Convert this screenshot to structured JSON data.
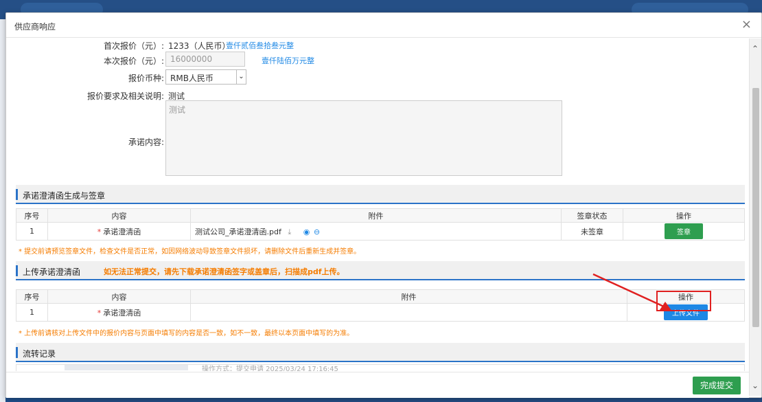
{
  "modal": {
    "title": "供应商响应"
  },
  "form": {
    "first_quote_label": "首次报价（元）:",
    "first_quote_value": "1233（人民币）",
    "first_quote_words": "壹仟贰佰叁拾叁元整",
    "this_quote_label": "本次报价（元）:",
    "this_quote_value": "16000000",
    "this_quote_words": "壹仟陆佰万元整",
    "currency_label": "报价币种:",
    "currency_value": "RMB人民币",
    "requirement_label": "报价要求及相关说明:",
    "requirement_value": "测试",
    "commitment_label": "承诺内容:",
    "commitment_value": "测试"
  },
  "section1": {
    "title": "承诺澄清函生成与签章",
    "headers": [
      "序号",
      "内容",
      "附件",
      "签章状态",
      "操作"
    ],
    "rows": [
      {
        "no": "1",
        "content": "承诺澄清函",
        "attachment": "测试公司_承诺澄清函.pdf",
        "status": "未签章",
        "action": "签章"
      }
    ],
    "note": "* 提交前请预览签章文件，检查文件是否正常，如因网络波动导致签章文件损坏，请删除文件后重新生成并签章。"
  },
  "section2": {
    "title": "上传承诺澄清函",
    "warning": "如无法正常提交，请先下载承诺澄清函签字或盖章后，扫描成pdf上传。",
    "headers": [
      "序号",
      "内容",
      "附件",
      "操作"
    ],
    "rows": [
      {
        "no": "1",
        "content": "承诺澄清函",
        "attachment": "",
        "action": "上传文件"
      }
    ],
    "note": "* 上传前请核对上传文件中的报价内容与页面中填写的内容是否一致，如不一致，最终以本页面中填写的为准。"
  },
  "section3": {
    "title": "流转记录",
    "partial_row": "操作方式：提交申请  2025/03/24 17:16:45"
  },
  "footer": {
    "submit_label": "完成提交"
  },
  "colors": {
    "accent": "#2a73c8",
    "success": "#2e9e4f",
    "warning": "#f57c00",
    "highlight": "#e02020"
  }
}
